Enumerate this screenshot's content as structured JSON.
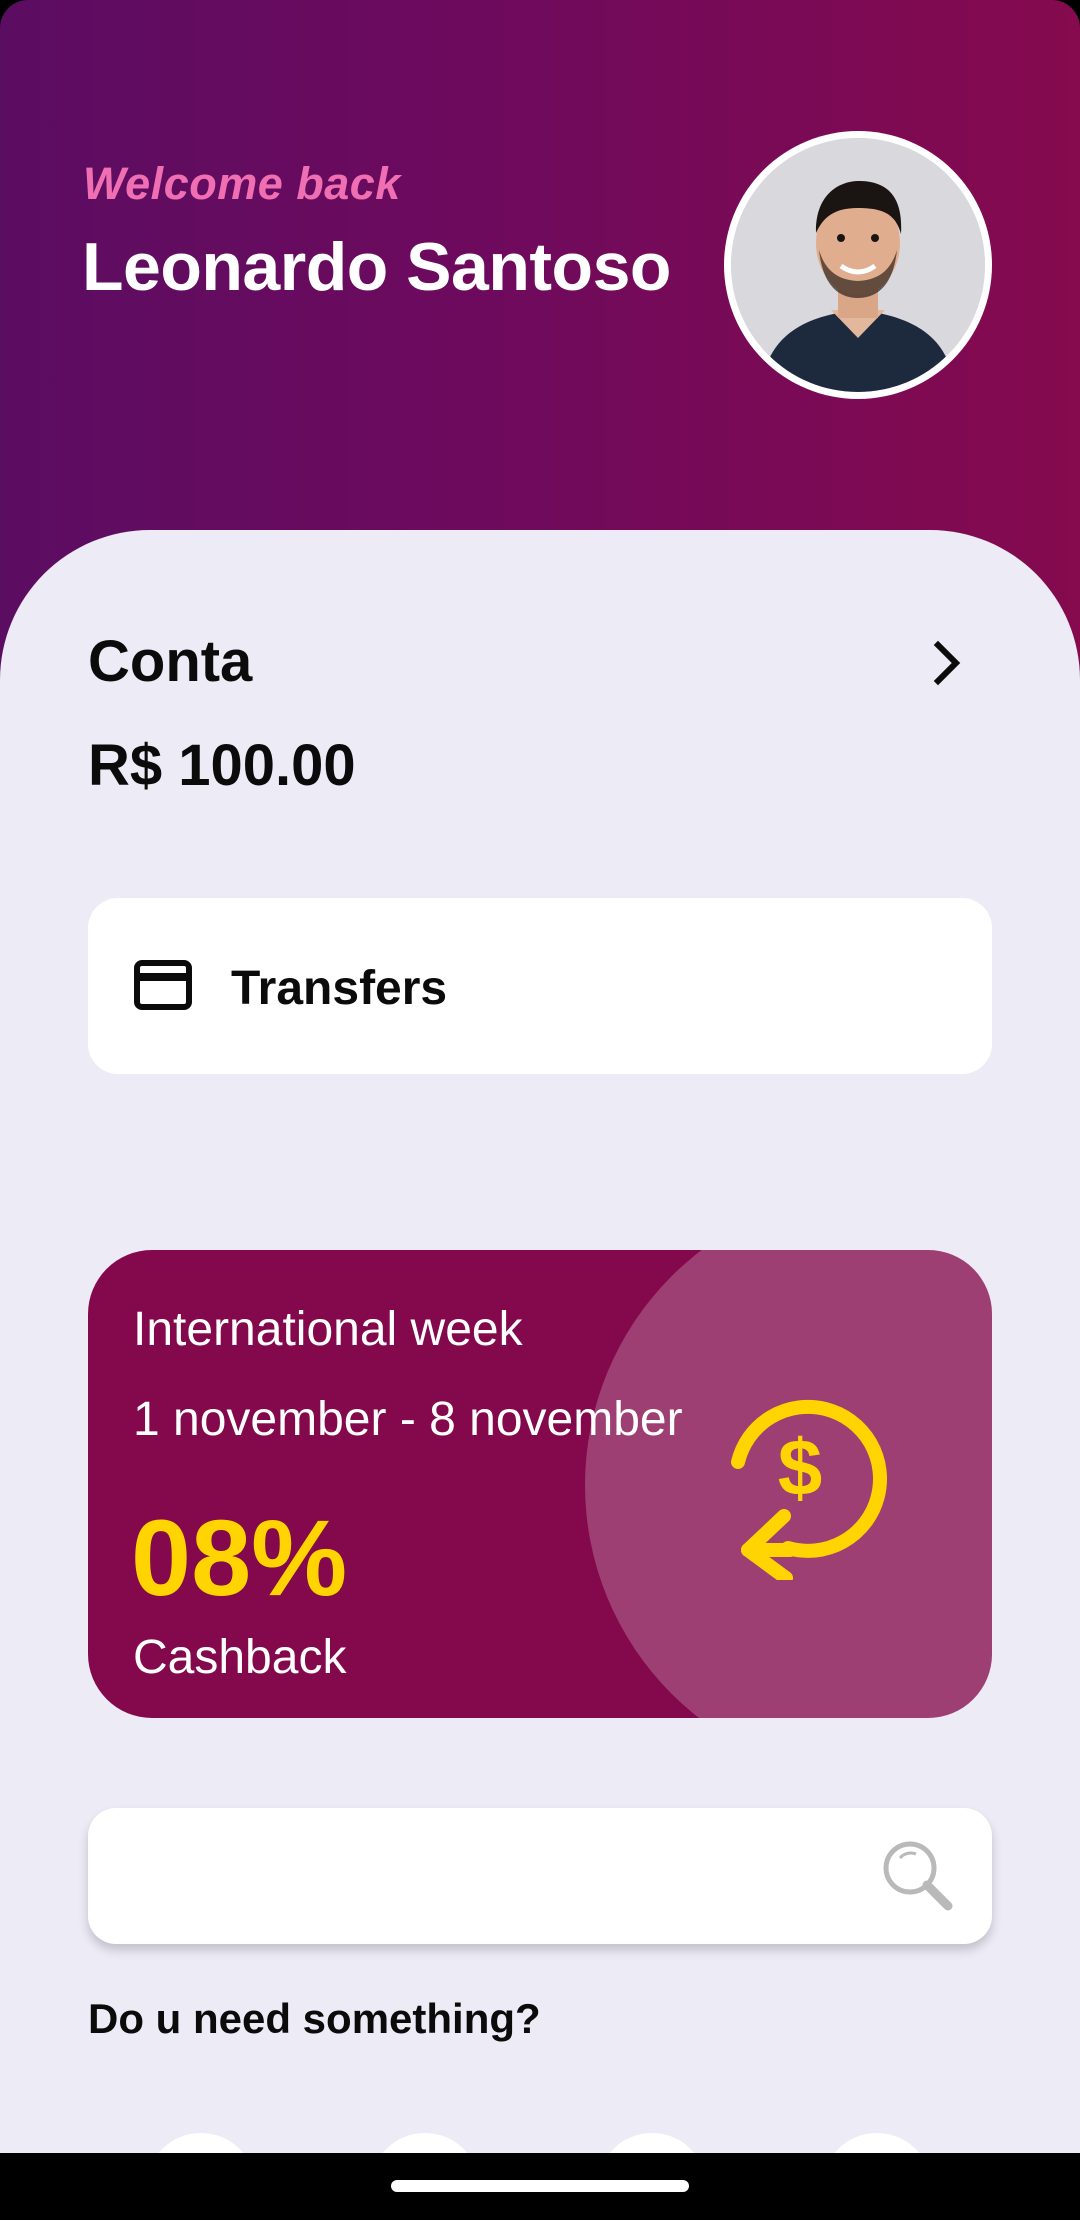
{
  "header": {
    "welcome_text": "Welcome back",
    "user_name": "Leonardo Santoso",
    "avatar_icon": "user-photo"
  },
  "account": {
    "title": "Conta",
    "balance": "R$ 100.00",
    "chevron_icon": "chevron-right-icon"
  },
  "transfers": {
    "label": "Transfers",
    "icon": "credit-card-icon"
  },
  "promo": {
    "title": "International week",
    "dates": "1 november - 8 november",
    "percent": "08%",
    "label": "Cashback",
    "icon": "cashback-icon"
  },
  "search": {
    "value": "",
    "placeholder": "",
    "icon": "search-icon"
  },
  "help_text": "Do u need something?",
  "colors": {
    "header_start": "#5b0d62",
    "header_end": "#850a4e",
    "accent_pink": "#f06fb3",
    "promo_bg": "#83094c",
    "cashback_yellow": "#ffd400",
    "sheet_bg": "#ecebf6"
  }
}
